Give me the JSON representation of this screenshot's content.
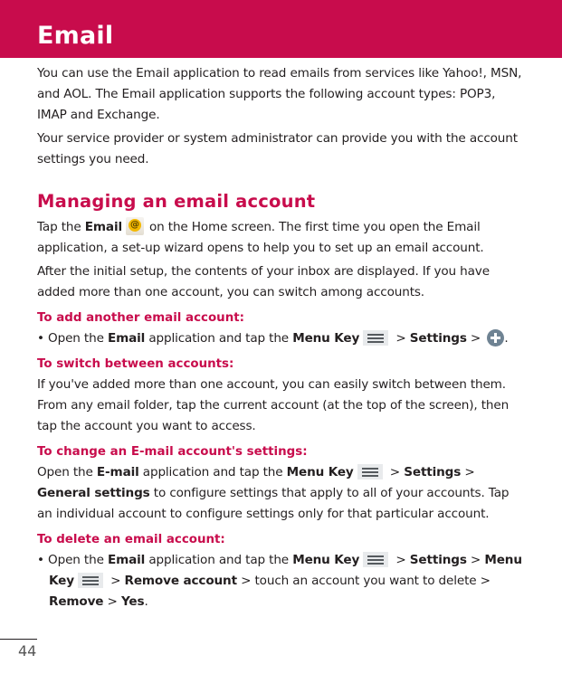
{
  "header": {
    "title": "Email"
  },
  "intro": {
    "p1": "You can use the Email application to read emails from services like Yahoo!, MSN, and AOL. The Email application supports the following account types: POP3, IMAP and Exchange.",
    "p2": "Your service provider or system administrator can provide you with the account settings you need."
  },
  "managing": {
    "heading": "Managing an email account",
    "p1_pre": "Tap the ",
    "p1_bold": "Email",
    "p1_icon": "email-app-icon",
    "p1_post": "on the Home screen. The first time you open the Email application, a set-up wizard opens to help you to set up an email account.",
    "p2": "After the initial setup, the contents of your inbox are displayed. If you have added more than one account, you can switch among accounts."
  },
  "add_account": {
    "heading": "To add another email account:",
    "bullet": "• ",
    "t1": "Open the ",
    "b1": "Email",
    "t2": " application and tap the ",
    "b2": "Menu Key",
    "t3": " > ",
    "b3": "Settings",
    "t4": " > ",
    "icon": "plus-circle-icon",
    "t5": "."
  },
  "switch_accounts": {
    "heading": "To switch between accounts:",
    "text": "If you've added more than one account, you can easily switch between them. From any email folder, tap the current account (at the top of the screen), then tap the account you want to access."
  },
  "change_settings": {
    "heading": "To change an E-mail account's settings:",
    "t1": "Open the ",
    "b1": "E-mail",
    "t2": " application and tap the ",
    "b2": "Menu Key",
    "t3": " > ",
    "b3": "Settings",
    "t4": " > ",
    "b4": "General settings",
    "t5": " to configure settings that apply to all of your accounts. Tap an individual account to configure settings only for that particular account."
  },
  "delete_account": {
    "heading": "To delete an email account:",
    "bullet": "• ",
    "t1": "Open the ",
    "b1": "Email",
    "t2": " application and tap the ",
    "b2": "Menu Key",
    "t3": " > ",
    "b3": "Settings",
    "t4": " > ",
    "b4": "Menu Key",
    "t5": " > ",
    "b5": "Remove account",
    "t6": " > touch an account you want to delete > ",
    "b6": "Remove",
    "t7": " > ",
    "b7": "Yes",
    "t8": "."
  },
  "footer": {
    "page_number": "44"
  },
  "colors": {
    "accent": "#c80c4c",
    "text": "#231f20"
  }
}
